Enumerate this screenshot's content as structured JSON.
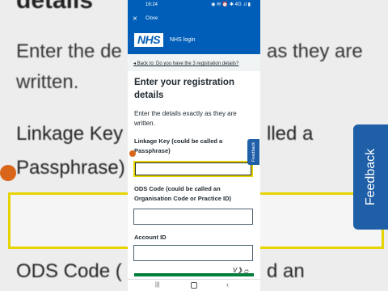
{
  "background": {
    "heading_top": "details",
    "para_line1a": "Enter the de",
    "para_line1b": "as they are",
    "para_line2": "written.",
    "heading1a": "Linkage Key",
    "heading1b": "lled a",
    "heading2": "Passphrase)",
    "heading3a": "ODS Code (",
    "heading3b": "d an",
    "feedback": "Feedback"
  },
  "statusbar": {
    "time": "16:24",
    "icons": "◉ ✉ ⏰ ✱ 4G .ıl ▮"
  },
  "topbar": {
    "close_icon": "×",
    "close_label": "Close"
  },
  "brand": {
    "logo": "NHS",
    "app_name": "NHS login",
    "accent": "#005eb8"
  },
  "back_link": "◂ Back to: Do you have the 3 registration details?",
  "form": {
    "title": "Enter your registration details",
    "intro": "Enter the details exactly as they are written.",
    "fields": [
      {
        "label": "Linkage Key (could be called a Passphrase)",
        "value": ""
      },
      {
        "label": "ODS Code (could be called an Organisation Code or Practice ID)",
        "value": ""
      },
      {
        "label": "Account ID",
        "value": ""
      }
    ]
  },
  "feedback_tab": "Feedback",
  "navbar": {
    "recents": "|||",
    "back": "‹"
  },
  "watermark": "V❯ ۝"
}
